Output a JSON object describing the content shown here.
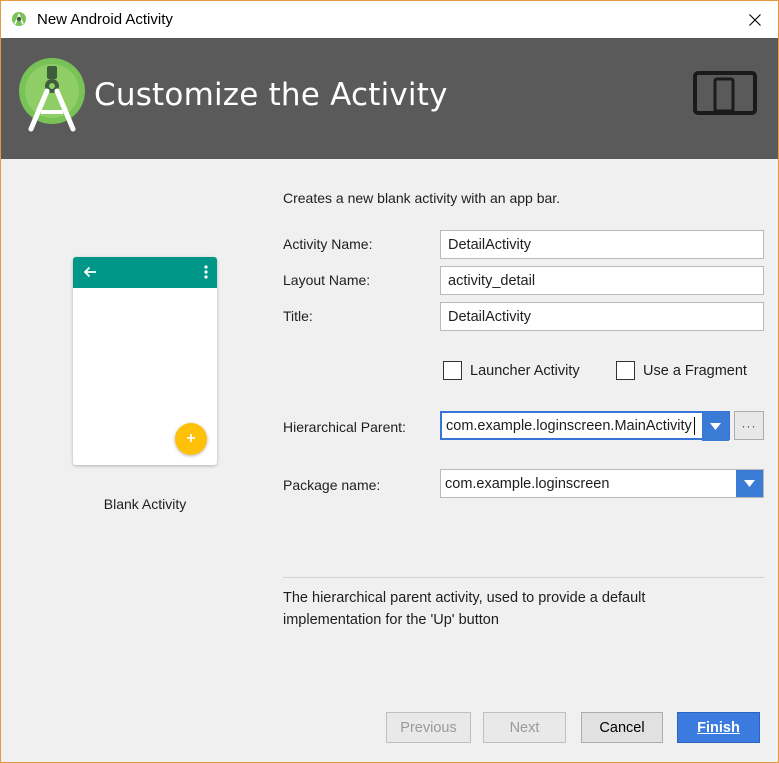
{
  "window": {
    "title": "New Android Activity",
    "app_icon": "android-studio-icon",
    "close_icon": "close-icon"
  },
  "header": {
    "title": "Customize the Activity",
    "logo": "android-studio-logo",
    "device_icon": "tablet-phone-icon",
    "background_color": "#5a5a5a"
  },
  "preview": {
    "template_label": "Blank Activity",
    "appbar_color": "#009688",
    "fab_color": "#ffc107",
    "fab_glyph": "+",
    "back_icon": "back-arrow-icon",
    "overflow_icon": "overflow-menu-icon"
  },
  "form": {
    "description": "Creates a new blank activity with an app bar.",
    "activity_name": {
      "label": "Activity Name:",
      "value": "DetailActivity"
    },
    "layout_name": {
      "label": "Layout Name:",
      "value": "activity_detail"
    },
    "title": {
      "label": "Title:",
      "value": "DetailActivity"
    },
    "launcher_activity": {
      "label": "Launcher Activity",
      "checked": false
    },
    "use_fragment": {
      "label": "Use a Fragment",
      "checked": false
    },
    "hierarchical_parent": {
      "label": "Hierarchical Parent:",
      "value": "com.example.loginscreen.MainActivity",
      "browse_label": "···"
    },
    "package_name": {
      "label": "Package name:",
      "value": "com.example.loginscreen"
    },
    "help_text_line1": "The hierarchical parent activity, used to provide a default",
    "help_text_line2": "implementation for the 'Up' button"
  },
  "buttons": {
    "previous": "Previous",
    "next": "Next",
    "cancel": "Cancel",
    "finish": "Finish",
    "accent_color": "#3b7be0"
  }
}
